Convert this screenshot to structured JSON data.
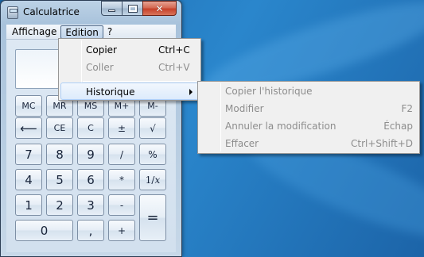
{
  "window": {
    "title": "Calculatrice",
    "close_glyph": "✕"
  },
  "menubar": {
    "items": [
      "Affichage",
      "Edition",
      "?"
    ]
  },
  "calculator": {
    "display_value": "",
    "buttons": {
      "mc": "MC",
      "mr": "MR",
      "ms": "MS",
      "mplus": "M+",
      "mminus": "M-",
      "backspace": "⟵",
      "ce": "CE",
      "c": "C",
      "plusminus": "±",
      "sqrt": "√",
      "seven": "7",
      "eight": "8",
      "nine": "9",
      "divide": "/",
      "percent": "%",
      "four": "4",
      "five": "5",
      "six": "6",
      "multiply": "*",
      "reciprocal": "1/𝑥",
      "one": "1",
      "two": "2",
      "three": "3",
      "minus": "-",
      "equals": "=",
      "zero": "0",
      "decimal": ",",
      "plus": "+"
    }
  },
  "edit_menu": {
    "items": [
      {
        "label": "Copier",
        "shortcut": "Ctrl+C",
        "enabled": true
      },
      {
        "label": "Coller",
        "shortcut": "Ctrl+V",
        "enabled": false
      },
      {
        "label": "Historique",
        "shortcut": "",
        "enabled": true,
        "submenu": true
      }
    ]
  },
  "history_menu": {
    "items": [
      {
        "label": "Copier l'historique",
        "shortcut": "",
        "enabled": false
      },
      {
        "label": "Modifier",
        "shortcut": "F2",
        "enabled": false
      },
      {
        "label": "Annuler la modification",
        "shortcut": "Échap",
        "enabled": false
      },
      {
        "label": "Effacer",
        "shortcut": "Ctrl+Shift+D",
        "enabled": false
      }
    ]
  }
}
